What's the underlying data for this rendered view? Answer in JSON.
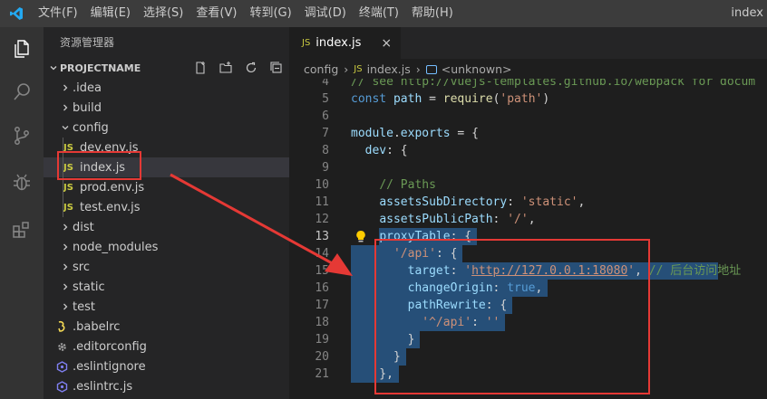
{
  "menu": {
    "items": [
      "文件(F)",
      "编辑(E)",
      "选择(S)",
      "查看(V)",
      "转到(G)",
      "调试(D)",
      "终端(T)",
      "帮助(H)"
    ],
    "window_title": "index"
  },
  "activitybar": {
    "icons": [
      "explorer-icon",
      "search-icon",
      "source-control-icon",
      "debug-icon",
      "extensions-icon"
    ]
  },
  "sidebar": {
    "title": "资源管理器",
    "section": "PROJECTNAME",
    "section_actions": [
      "new-file-icon",
      "new-folder-icon",
      "refresh-icon",
      "collapse-all-icon"
    ],
    "items": [
      {
        "label": ".idea",
        "kind": "folder",
        "expanded": false,
        "depth": 0
      },
      {
        "label": "build",
        "kind": "folder",
        "expanded": false,
        "depth": 0
      },
      {
        "label": "config",
        "kind": "folder",
        "expanded": true,
        "depth": 0
      },
      {
        "label": "dev.env.js",
        "kind": "js",
        "depth": 1
      },
      {
        "label": "index.js",
        "kind": "js",
        "depth": 1,
        "selected": true
      },
      {
        "label": "prod.env.js",
        "kind": "js",
        "depth": 1
      },
      {
        "label": "test.env.js",
        "kind": "js",
        "depth": 1
      },
      {
        "label": "dist",
        "kind": "folder",
        "expanded": false,
        "depth": 0
      },
      {
        "label": "node_modules",
        "kind": "folder",
        "expanded": false,
        "depth": 0
      },
      {
        "label": "src",
        "kind": "folder",
        "expanded": false,
        "depth": 0
      },
      {
        "label": "static",
        "kind": "folder",
        "expanded": false,
        "depth": 0
      },
      {
        "label": "test",
        "kind": "folder",
        "expanded": false,
        "depth": 0
      },
      {
        "label": ".babelrc",
        "kind": "babel",
        "depth": 0
      },
      {
        "label": ".editorconfig",
        "kind": "gear",
        "depth": 0
      },
      {
        "label": ".eslintignore",
        "kind": "eslint",
        "depth": 0
      },
      {
        "label": ".eslintrc.js",
        "kind": "eslint",
        "depth": 0
      }
    ]
  },
  "editor": {
    "tab": {
      "label": "index.js",
      "icon": "JS",
      "close": "×"
    },
    "breadcrumb": [
      "config",
      "index.js",
      "<unknown>"
    ],
    "file_icon_text": "JS",
    "lines": [
      {
        "n": "4",
        "tokens": [
          {
            "t": "// see http://vuejs-templates.github.io/webpack for docum",
            "c": "cm"
          }
        ]
      },
      {
        "n": "5",
        "tokens": [
          {
            "t": "const ",
            "c": "kw"
          },
          {
            "t": "path",
            "c": "var"
          },
          {
            "t": " = ",
            "c": ""
          },
          {
            "t": "require",
            "c": "fn"
          },
          {
            "t": "(",
            "c": ""
          },
          {
            "t": "'path'",
            "c": "str"
          },
          {
            "t": ")",
            "c": ""
          }
        ]
      },
      {
        "n": "6",
        "tokens": []
      },
      {
        "n": "7",
        "tokens": [
          {
            "t": "module",
            "c": "var"
          },
          {
            "t": ".",
            "c": ""
          },
          {
            "t": "exports",
            "c": "var"
          },
          {
            "t": " = {",
            "c": ""
          }
        ]
      },
      {
        "n": "8",
        "tokens": [
          {
            "t": "  ",
            "c": ""
          },
          {
            "t": "dev",
            "c": "var"
          },
          {
            "t": ": {",
            "c": ""
          }
        ]
      },
      {
        "n": "9",
        "tokens": []
      },
      {
        "n": "10",
        "tokens": [
          {
            "t": "    ",
            "c": ""
          },
          {
            "t": "// Paths",
            "c": "cm"
          }
        ]
      },
      {
        "n": "11",
        "tokens": [
          {
            "t": "    ",
            "c": ""
          },
          {
            "t": "assetsSubDirectory",
            "c": "var"
          },
          {
            "t": ": ",
            "c": ""
          },
          {
            "t": "'static'",
            "c": "str"
          },
          {
            "t": ",",
            "c": ""
          }
        ]
      },
      {
        "n": "12",
        "tokens": [
          {
            "t": "    ",
            "c": ""
          },
          {
            "t": "assetsPublicPath",
            "c": "var"
          },
          {
            "t": ": ",
            "c": ""
          },
          {
            "t": "'/'",
            "c": "str"
          },
          {
            "t": ",",
            "c": ""
          }
        ]
      },
      {
        "n": "13",
        "tokens": [
          {
            "t": "    ",
            "c": ""
          },
          {
            "t": "proxyTable",
            "c": "var"
          },
          {
            "t": ": {",
            "c": ""
          }
        ]
      },
      {
        "n": "14",
        "tokens": [
          {
            "t": "      ",
            "c": ""
          },
          {
            "t": "'/api'",
            "c": "str"
          },
          {
            "t": ": {",
            "c": ""
          }
        ]
      },
      {
        "n": "15",
        "tokens": [
          {
            "t": "        ",
            "c": ""
          },
          {
            "t": "target",
            "c": "var"
          },
          {
            "t": ": ",
            "c": ""
          },
          {
            "t": "'",
            "c": "str"
          },
          {
            "t": "http://127.0.0.1:18080",
            "c": "str url"
          },
          {
            "t": "'",
            "c": "str"
          },
          {
            "t": ", ",
            "c": ""
          },
          {
            "t": "// 后台访问地址",
            "c": "cm"
          }
        ]
      },
      {
        "n": "16",
        "tokens": [
          {
            "t": "        ",
            "c": ""
          },
          {
            "t": "changeOrigin",
            "c": "var"
          },
          {
            "t": ": ",
            "c": ""
          },
          {
            "t": "true",
            "c": "lit"
          },
          {
            "t": ",",
            "c": ""
          }
        ]
      },
      {
        "n": "17",
        "tokens": [
          {
            "t": "        ",
            "c": ""
          },
          {
            "t": "pathRewrite",
            "c": "var"
          },
          {
            "t": ": {",
            "c": ""
          }
        ]
      },
      {
        "n": "18",
        "tokens": [
          {
            "t": "          ",
            "c": ""
          },
          {
            "t": "'^/api'",
            "c": "str"
          },
          {
            "t": ": ",
            "c": ""
          },
          {
            "t": "''",
            "c": "str"
          }
        ]
      },
      {
        "n": "19",
        "tokens": [
          {
            "t": "        }",
            "c": ""
          }
        ]
      },
      {
        "n": "20",
        "tokens": [
          {
            "t": "      }",
            "c": ""
          }
        ]
      },
      {
        "n": "21",
        "tokens": [
          {
            "t": "    },",
            "c": ""
          }
        ]
      }
    ],
    "selection": {
      "from_line": "13",
      "to_line": "21"
    },
    "active_line": "13",
    "lightbulb_line": "13"
  },
  "colors": {
    "annotation": "#e53935",
    "selection": "#264f78",
    "js_icon": "#cbcb41"
  }
}
